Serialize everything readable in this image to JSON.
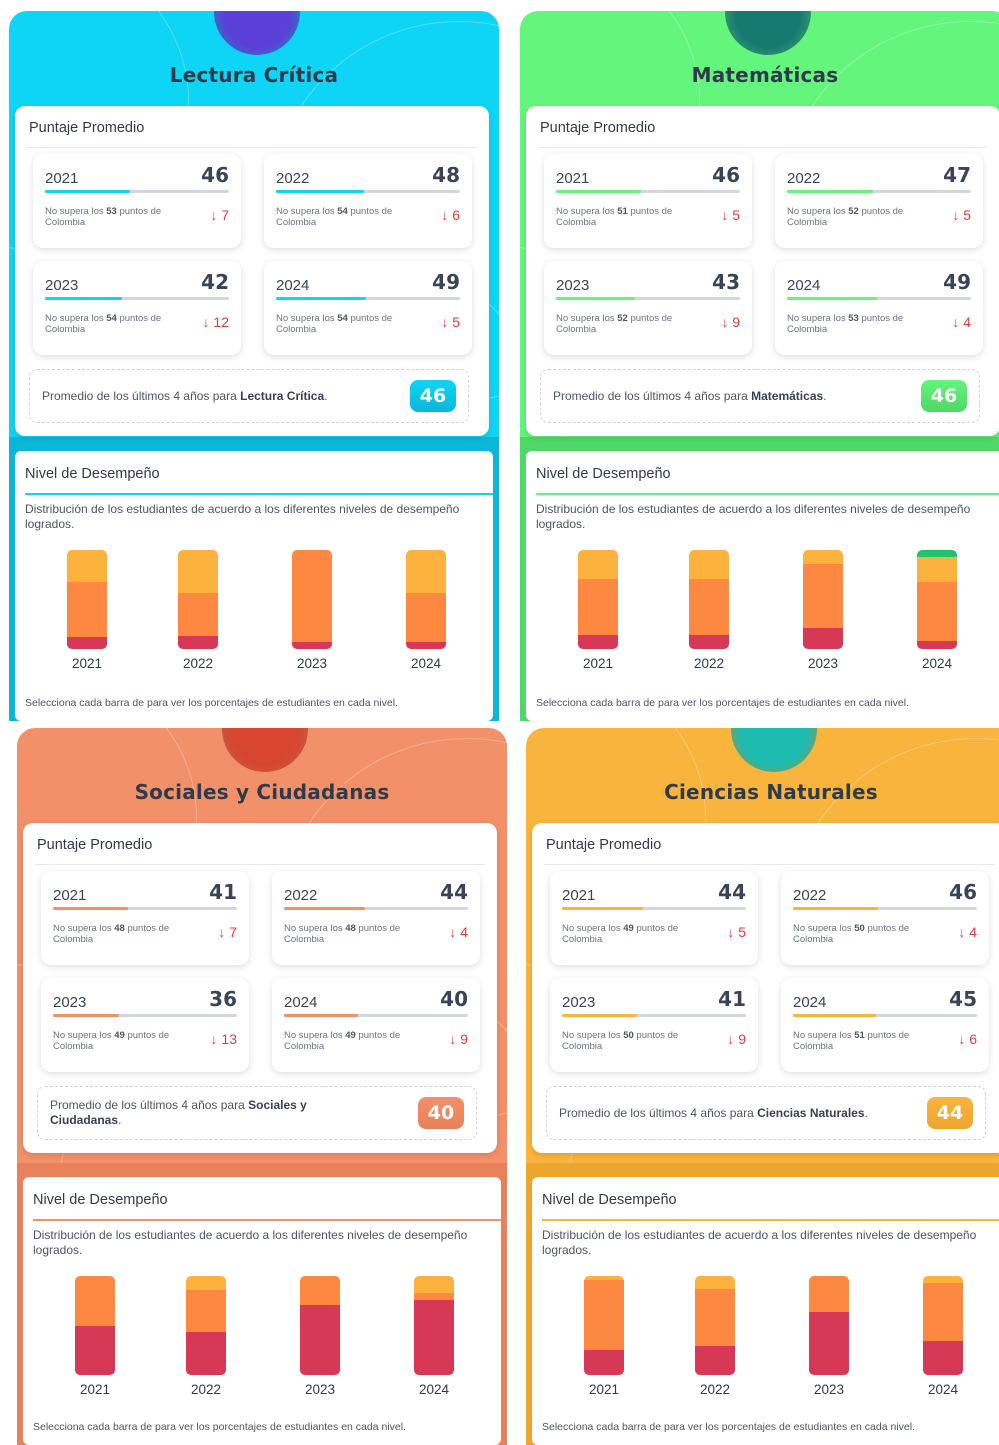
{
  "common": {
    "score_card_title": "Puntaje Promedio",
    "performance_title": "Nivel de Desempeño",
    "performance_description": "Distribución de los estudiantes de acuerdo a los diferentes niveles de desempeño logrados.",
    "performance_hint": "Selecciona cada barra de para ver los porcentajes de estudiantes en cada nivel.",
    "comparison_prefix": "No supera los",
    "comparison_suffix": "puntos de Colombia",
    "delta_icon": "arrow-down-icon",
    "average_prefix": "Promedio de los últimos 4 años para",
    "level_colors": [
      "#1fc36b",
      "#fdb23e",
      "#fd8841",
      "#d63856"
    ]
  },
  "subjects": [
    {
      "name": "Lectura Crítica",
      "accent": "#0ed5f5",
      "accent_dark": "#0bb7d8",
      "orb_color": "#5b3fd6",
      "average": "46",
      "years": [
        {
          "year": "2021",
          "score": "46",
          "colombia": "53",
          "delta": "7",
          "fill": 0.46
        },
        {
          "year": "2022",
          "score": "48",
          "colombia": "54",
          "delta": "6",
          "fill": 0.48
        },
        {
          "year": "2023",
          "score": "42",
          "colombia": "54",
          "delta": "12",
          "fill": 0.42
        },
        {
          "year": "2024",
          "score": "49",
          "colombia": "54",
          "delta": "5",
          "fill": 0.49
        }
      ],
      "levels": [
        {
          "year": "2021",
          "pct": [
            0,
            32,
            56,
            12
          ]
        },
        {
          "year": "2022",
          "pct": [
            0,
            43,
            44,
            13
          ]
        },
        {
          "year": "2023",
          "pct": [
            0,
            0,
            93,
            7
          ]
        },
        {
          "year": "2024",
          "pct": [
            0,
            43,
            50,
            7
          ]
        }
      ]
    },
    {
      "name": "Matemáticas",
      "accent": "#64f57c",
      "accent_dark": "#4fd868",
      "orb_color": "#177a72",
      "average": "46",
      "years": [
        {
          "year": "2021",
          "score": "46",
          "colombia": "51",
          "delta": "5",
          "fill": 0.46
        },
        {
          "year": "2022",
          "score": "47",
          "colombia": "52",
          "delta": "5",
          "fill": 0.47
        },
        {
          "year": "2023",
          "score": "43",
          "colombia": "52",
          "delta": "9",
          "fill": 0.43
        },
        {
          "year": "2024",
          "score": "49",
          "colombia": "53",
          "delta": "4",
          "fill": 0.49
        }
      ],
      "levels": [
        {
          "year": "2021",
          "pct": [
            0,
            29,
            57,
            14
          ]
        },
        {
          "year": "2022",
          "pct": [
            0,
            29,
            57,
            14
          ]
        },
        {
          "year": "2023",
          "pct": [
            0,
            14,
            65,
            21
          ]
        },
        {
          "year": "2024",
          "pct": [
            7,
            25,
            60,
            8
          ]
        }
      ]
    },
    {
      "name": "Sociales y Ciudadanas",
      "accent": "#f2906a",
      "accent_dark": "#e8815a",
      "orb_color": "#d8452e",
      "average": "40",
      "years": [
        {
          "year": "2021",
          "score": "41",
          "colombia": "48",
          "delta": "7",
          "fill": 0.41
        },
        {
          "year": "2022",
          "score": "44",
          "colombia": "48",
          "delta": "4",
          "fill": 0.44
        },
        {
          "year": "2023",
          "score": "36",
          "colombia": "49",
          "delta": "13",
          "fill": 0.36
        },
        {
          "year": "2024",
          "score": "40",
          "colombia": "49",
          "delta": "9",
          "fill": 0.4
        }
      ],
      "levels": [
        {
          "year": "2021",
          "pct": [
            0,
            0,
            50,
            50
          ]
        },
        {
          "year": "2022",
          "pct": [
            0,
            14,
            43,
            43
          ]
        },
        {
          "year": "2023",
          "pct": [
            0,
            0,
            29,
            71
          ]
        },
        {
          "year": "2024",
          "pct": [
            0,
            17,
            7,
            76
          ]
        }
      ]
    },
    {
      "name": "Ciencias Naturales",
      "accent": "#f8b43c",
      "accent_dark": "#eda52e",
      "orb_color": "#1dbcb0",
      "average": "44",
      "years": [
        {
          "year": "2021",
          "score": "44",
          "colombia": "49",
          "delta": "5",
          "fill": 0.44
        },
        {
          "year": "2022",
          "score": "46",
          "colombia": "50",
          "delta": "4",
          "fill": 0.46
        },
        {
          "year": "2023",
          "score": "41",
          "colombia": "50",
          "delta": "9",
          "fill": 0.41
        },
        {
          "year": "2024",
          "score": "45",
          "colombia": "51",
          "delta": "6",
          "fill": 0.45
        }
      ],
      "levels": [
        {
          "year": "2021",
          "pct": [
            0,
            4,
            71,
            25
          ]
        },
        {
          "year": "2022",
          "pct": [
            0,
            13,
            58,
            29
          ]
        },
        {
          "year": "2023",
          "pct": [
            0,
            0,
            36,
            64
          ]
        },
        {
          "year": "2024",
          "pct": [
            0,
            7,
            59,
            34
          ]
        }
      ]
    }
  ]
}
